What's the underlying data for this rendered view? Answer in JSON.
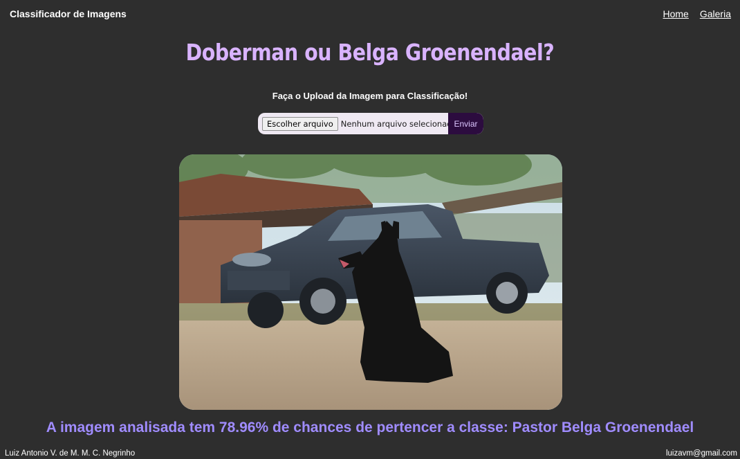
{
  "navbar": {
    "brand": "Classificador de Imagens",
    "links": [
      "Home",
      "Galeria"
    ]
  },
  "main": {
    "title": "Doberman ou Belga Groenendael?",
    "subtitle": "Faça o Upload da Imagem para Classificação!",
    "upload": {
      "choose_label": "Escolher arquivo",
      "status": "Nenhum arquivo selecionado",
      "submit_label": "Enviar"
    },
    "result": "A imagem analisada tem 78.96% de chances de pertencer a classe: Pastor Belga Groenendael"
  },
  "footer": {
    "author": "Luiz Antonio V. de M. M. C. Negrinho",
    "email": "luizavm@gmail.com"
  },
  "colors": {
    "background": "#2e2e2e",
    "title": "#d9b3ff",
    "result": "#a08cff",
    "submit": "#2c0c3f"
  }
}
